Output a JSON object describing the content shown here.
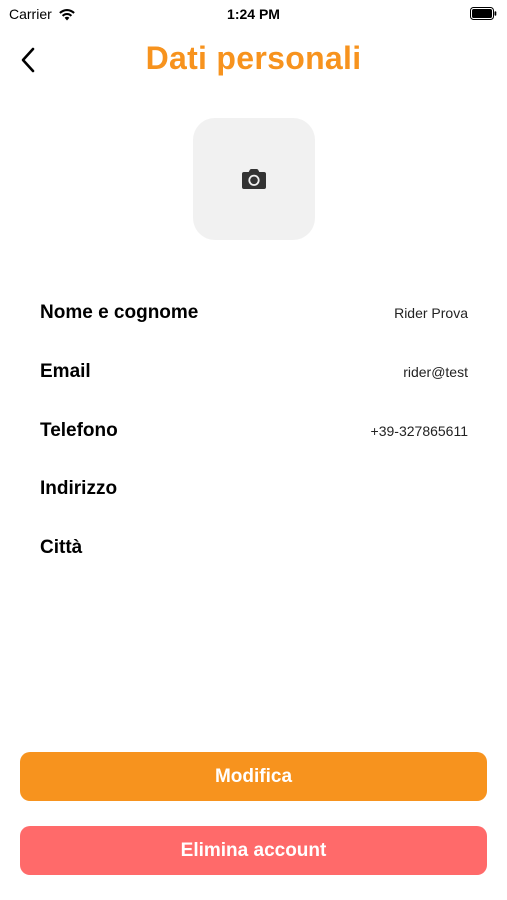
{
  "status_bar": {
    "carrier": "Carrier",
    "time": "1:24 PM"
  },
  "header": {
    "title": "Dati personali",
    "back_icon": "chevron-left-icon",
    "title_color": "#f7931e"
  },
  "avatar": {
    "icon": "camera-icon",
    "background": "#f1f1f1"
  },
  "fields": [
    {
      "label": "Nome e cognome",
      "value": "Rider Prova"
    },
    {
      "label": "Email",
      "value": "rider@test"
    },
    {
      "label": "Telefono",
      "value": "+39-327865611"
    },
    {
      "label": "Indirizzo",
      "value": ""
    },
    {
      "label": "Città",
      "value": ""
    }
  ],
  "actions": {
    "edit_label": "Modifica",
    "edit_color": "#f7931e",
    "delete_label": "Elimina account",
    "delete_color": "#ff6a6a"
  }
}
